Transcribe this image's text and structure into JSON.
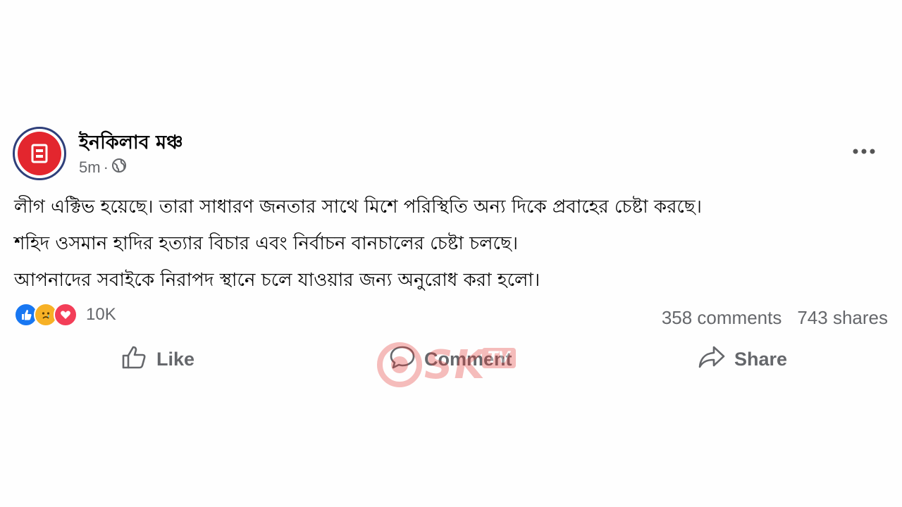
{
  "post": {
    "page_name": "ইনকিলাব মঞ্চ",
    "time": "5m",
    "separator": "·",
    "lines": [
      "লীগ এক্টিভ হয়েছে। তারা সাধারণ জনতার সাথে মিশে পরিস্থিতি অন্য দিকে প্রবাহের চেষ্টা করছে।",
      "শহিদ ওসমান হাদির হত্যার বিচার এবং নির্বাচন বানচালের চেষ্টা চলছে।",
      "আপনাদের সবাইকে নিরাপদ স্থানে চলে যাওয়ার জন্য অনুরোধ করা হলো।"
    ]
  },
  "engagement": {
    "reaction_count": "10K",
    "comments": "358 comments",
    "shares": "743 shares"
  },
  "actions": {
    "like": "Like",
    "comment": "Comment",
    "share": "Share"
  },
  "watermark": {
    "brand": "SK",
    "suffix": "TV"
  },
  "icons": {
    "avatar": "page-logo",
    "privacy": "globe-icon",
    "more": "more-options-icon",
    "like": "thumbs-up-icon",
    "comment": "comment-bubble-icon",
    "share": "share-arrow-icon"
  },
  "colors": {
    "accent_red": "#e3262e",
    "like_blue": "#1877f2",
    "muted": "#65676b"
  }
}
